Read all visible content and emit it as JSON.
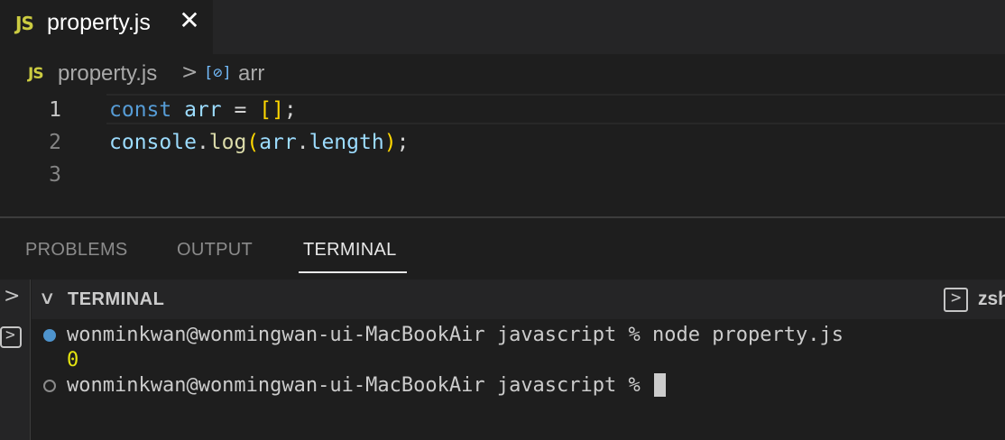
{
  "tab": {
    "icon_label": "JS",
    "title": "property.js",
    "close_glyph": "✕"
  },
  "breadcrumb": {
    "icon_label": "JS",
    "file": "property.js",
    "separator": ">",
    "symbol_icon": "[⊘]",
    "symbol": "arr"
  },
  "editor": {
    "line_numbers": [
      "1",
      "2",
      "3"
    ],
    "line1": {
      "kw": "const",
      "name": "arr",
      "eq": " = ",
      "open": "[",
      "close": "]",
      "end": ";"
    },
    "line2": {
      "obj": "console",
      "dot": ".",
      "fn": "log",
      "open": "(",
      "arg": "arr",
      "dot2": ".",
      "prop": "length",
      "close": ")",
      "end": ";"
    }
  },
  "panel": {
    "tabs": [
      "PROBLEMS",
      "OUTPUT",
      "TERMINAL"
    ],
    "active_tab": "TERMINAL",
    "header": {
      "chevron": "∨",
      "label": "TERMINAL",
      "shell": "zsh"
    },
    "sidebar_chevron": ">"
  },
  "terminal": {
    "lines": [
      "wonminkwan@wonmingwan-ui-MacBookAir javascript % node property.js",
      "0",
      "wonminkwan@wonmingwan-ui-MacBookAir javascript % "
    ]
  },
  "colors": {
    "keyword": "#569cd6",
    "variable": "#9cdcfe",
    "function": "#dcdcaa",
    "bracket": "#ffd700",
    "output": "#e5e510",
    "js_icon": "#cbcb41"
  }
}
